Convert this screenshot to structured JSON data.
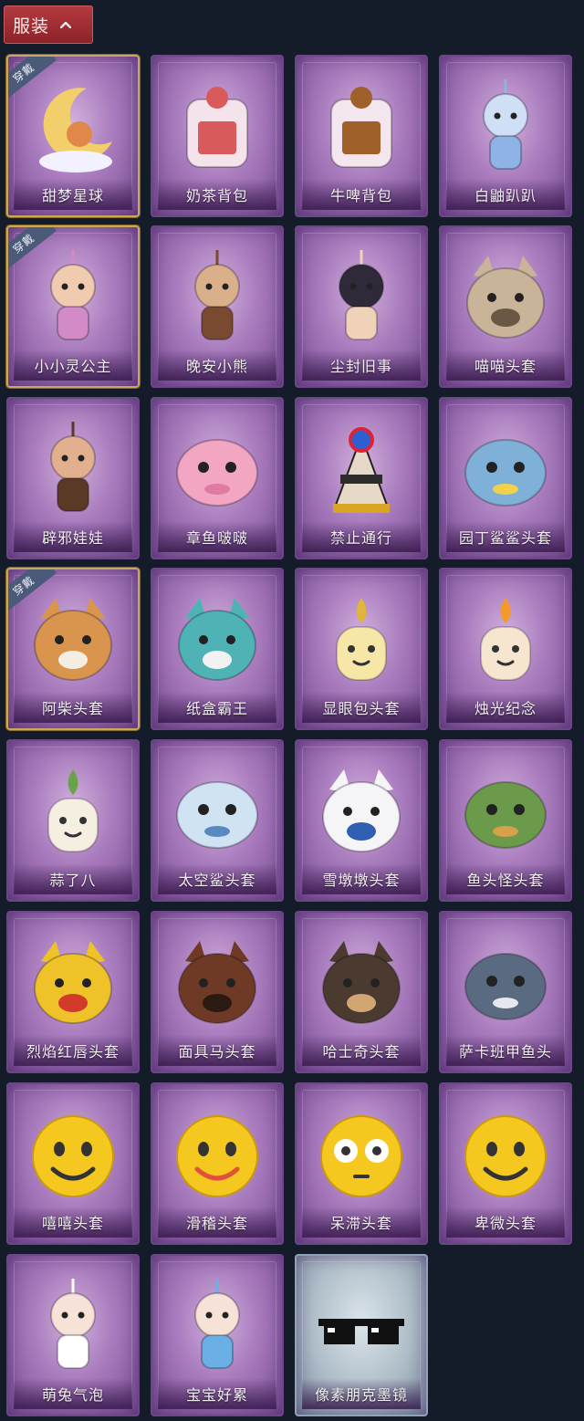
{
  "header": {
    "label": "服装",
    "chevron_icon": "chevron-up-icon"
  },
  "badge_text": "穿戴",
  "items": [
    {
      "name": "甜梦星球",
      "equipped": true,
      "icon": "dream-moon-icon",
      "color": "#f2cf6a",
      "accent": "#e0884a"
    },
    {
      "name": "奶茶背包",
      "equipped": false,
      "icon": "milktea-backpack-icon",
      "color": "#f4e3ea",
      "accent": "#d85a5a"
    },
    {
      "name": "牛啤背包",
      "equipped": false,
      "icon": "cow-beer-backpack-icon",
      "color": "#f3e6ee",
      "accent": "#a0602a"
    },
    {
      "name": "白鼬趴趴",
      "equipped": false,
      "icon": "white-ferret-icon",
      "color": "#cfe0f6",
      "accent": "#8fb3e6"
    },
    {
      "name": "小小灵公主",
      "equipped": true,
      "icon": "little-princess-icon",
      "color": "#f0cbb0",
      "accent": "#d28bc6"
    },
    {
      "name": "晚安小熊",
      "equipped": false,
      "icon": "goodnight-bear-icon",
      "color": "#d9b08a",
      "accent": "#7a4a30"
    },
    {
      "name": "尘封旧事",
      "equipped": false,
      "icon": "dusty-prince-icon",
      "color": "#2e2a3a",
      "accent": "#f0d2b8"
    },
    {
      "name": "喵喵头套",
      "equipped": false,
      "icon": "cat-head-icon",
      "color": "#c9b49a",
      "accent": "#6b5844"
    },
    {
      "name": "辟邪娃娃",
      "equipped": false,
      "icon": "charm-doll-icon",
      "color": "#e2b08e",
      "accent": "#5a3a26"
    },
    {
      "name": "章鱼啵啵",
      "equipped": false,
      "icon": "octopus-icon",
      "color": "#f2a6c2",
      "accent": "#e07aa2"
    },
    {
      "name": "禁止通行",
      "equipped": false,
      "icon": "no-entry-cone-icon",
      "color": "#e7d9c7",
      "accent": "#2c2c2c"
    },
    {
      "name": "园丁鲨鲨头套",
      "equipped": false,
      "icon": "gardener-shark-icon",
      "color": "#7fb0d8",
      "accent": "#f2d14a"
    },
    {
      "name": "阿柴头套",
      "equipped": true,
      "icon": "shiba-head-icon",
      "color": "#d9944e",
      "accent": "#f4ede2"
    },
    {
      "name": "纸盒霸王",
      "equipped": false,
      "icon": "box-dino-icon",
      "color": "#4fb3b6",
      "accent": "#f2f2f2"
    },
    {
      "name": "显眼包头套",
      "equipped": false,
      "icon": "bulb-head-icon",
      "color": "#f6e7a6",
      "accent": "#e0b53a"
    },
    {
      "name": "烛光纪念",
      "equipped": false,
      "icon": "candle-icon",
      "color": "#f7e6cf",
      "accent": "#f59a2a"
    },
    {
      "name": "蒜了八",
      "equipped": false,
      "icon": "garlic-icon",
      "color": "#f5efe2",
      "accent": "#6aa24a"
    },
    {
      "name": "太空鲨头套",
      "equipped": false,
      "icon": "space-shark-icon",
      "color": "#cfe3f2",
      "accent": "#5a88c0"
    },
    {
      "name": "雪墩墩头套",
      "equipped": false,
      "icon": "snowman-head-icon",
      "color": "#f5f5f7",
      "accent": "#2f5fb0"
    },
    {
      "name": "鱼头怪头套",
      "equipped": false,
      "icon": "fish-monster-icon",
      "color": "#6a9a4a",
      "accent": "#d9a04a"
    },
    {
      "name": "烈焰红唇头套",
      "equipped": false,
      "icon": "red-lips-head-icon",
      "color": "#f0c22a",
      "accent": "#d23a2a"
    },
    {
      "name": "面具马头套",
      "equipped": false,
      "icon": "horse-mask-icon",
      "color": "#6e3a26",
      "accent": "#2a1a12"
    },
    {
      "name": "哈士奇头套",
      "equipped": false,
      "icon": "husky-head-icon",
      "color": "#4a3a30",
      "accent": "#d2a672"
    },
    {
      "name": "萨卡班甲鱼头",
      "equipped": false,
      "icon": "sacabambaspis-icon",
      "color": "#5a6a80",
      "accent": "#e6e8ee"
    },
    {
      "name": "嘻嘻头套",
      "equipped": false,
      "icon": "grin-emoji-icon",
      "color": "#f5c81f",
      "accent": "#333333"
    },
    {
      "name": "滑稽头套",
      "equipped": false,
      "icon": "funny-emoji-icon",
      "color": "#f5c81f",
      "accent": "#e0503a"
    },
    {
      "name": "呆滞头套",
      "equipped": false,
      "icon": "dazed-emoji-icon",
      "color": "#f5c81f",
      "accent": "#ffffff"
    },
    {
      "name": "卑微头套",
      "equipped": false,
      "icon": "humble-emoji-icon",
      "color": "#f5c81f",
      "accent": "#333333"
    },
    {
      "name": "萌兔气泡",
      "equipped": false,
      "icon": "bunny-bubble-icon",
      "color": "#f7e2d8",
      "accent": "#ffffff"
    },
    {
      "name": "宝宝好累",
      "equipped": false,
      "icon": "tired-baby-icon",
      "color": "#f7e2d8",
      "accent": "#6ab0e6"
    },
    {
      "name": "像素朋克墨镜",
      "equipped": false,
      "icon": "pixel-sunglasses-icon",
      "color": "#111111",
      "accent": "#ffffff",
      "special": true
    }
  ]
}
